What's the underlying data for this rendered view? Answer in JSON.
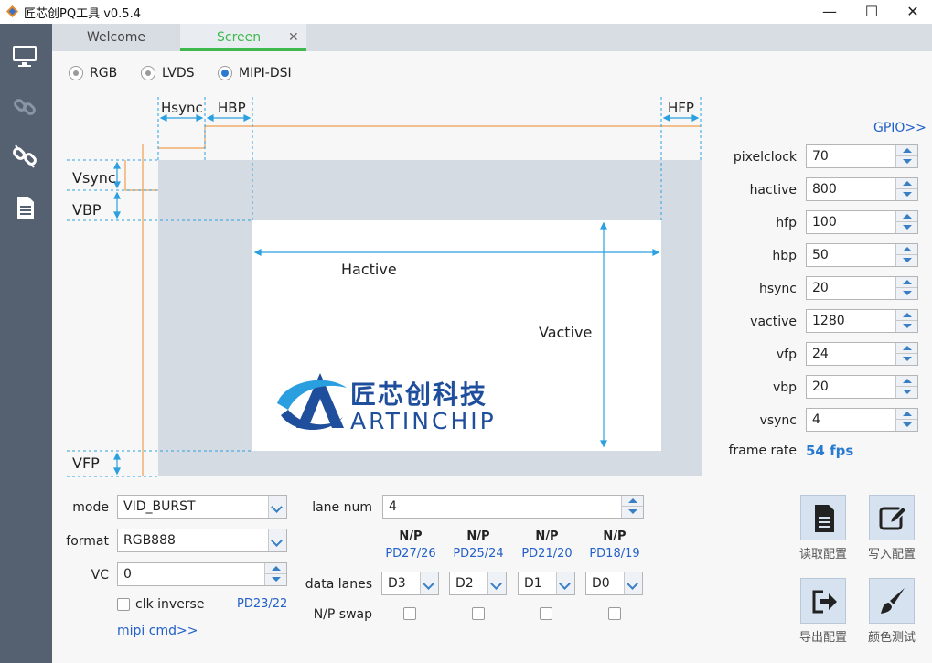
{
  "window": {
    "title": "匠芯创PQ工具 v0.5.4",
    "minimize": "—",
    "maximize": "☐",
    "close": "✕"
  },
  "tabs": [
    {
      "label": "Welcome"
    },
    {
      "label": "Screen",
      "close": "✕"
    }
  ],
  "interface": {
    "options": [
      "RGB",
      "LVDS",
      "MIPI-DSI"
    ],
    "selected": "MIPI-DSI"
  },
  "diagram": {
    "hsync": "Hsync",
    "hbp": "HBP",
    "hfp": "HFP",
    "vsync": "Vsync",
    "vbp": "VBP",
    "vfp": "VFP",
    "hactive": "Hactive",
    "vactive": "Vactive",
    "logo_cn": "匠芯创科技",
    "logo_en": "ARTINCHIP"
  },
  "gpio_link": "GPIO>>",
  "params": [
    {
      "label": "pixelclock",
      "value": "70"
    },
    {
      "label": "hactive",
      "value": "800"
    },
    {
      "label": "hfp",
      "value": "100"
    },
    {
      "label": "hbp",
      "value": "50"
    },
    {
      "label": "hsync",
      "value": "20"
    },
    {
      "label": "vactive",
      "value": "1280"
    },
    {
      "label": "vfp",
      "value": "24"
    },
    {
      "label": "vbp",
      "value": "20"
    },
    {
      "label": "vsync",
      "value": "4"
    }
  ],
  "frame_rate": {
    "label": "frame rate",
    "value": "54 fps"
  },
  "mipi": {
    "mode_label": "mode",
    "mode_value": "VID_BURST",
    "format_label": "format",
    "format_value": "RGB888",
    "vc_label": "VC",
    "vc_value": "0",
    "clk_inverse_label": "clk inverse",
    "clk_pin": "PD23/22",
    "mipi_cmd_link": "mipi cmd>>",
    "lane_num_label": "lane num",
    "lane_num_value": "4",
    "lanes": [
      {
        "np": "N/P",
        "pins": "PD27/26",
        "value": "D3"
      },
      {
        "np": "N/P",
        "pins": "PD25/24",
        "value": "D2"
      },
      {
        "np": "N/P",
        "pins": "PD21/20",
        "value": "D1"
      },
      {
        "np": "N/P",
        "pins": "PD18/19",
        "value": "D0"
      }
    ],
    "data_lanes_label": "data lanes",
    "np_swap_label": "N/P swap"
  },
  "actions": [
    {
      "label": "读取配置",
      "icon": "document-icon"
    },
    {
      "label": "写入配置",
      "icon": "edit-icon"
    },
    {
      "label": "导出配置",
      "icon": "export-icon"
    },
    {
      "label": "颜色测试",
      "icon": "brush-icon"
    }
  ],
  "colors": {
    "sidebar": "#556070",
    "accent": "#2a7bd0",
    "tab_active": "#3fb84d",
    "timing_line": "#f0a050",
    "dim_line": "#2aa0e0",
    "blanking": "#d5dbe3"
  }
}
